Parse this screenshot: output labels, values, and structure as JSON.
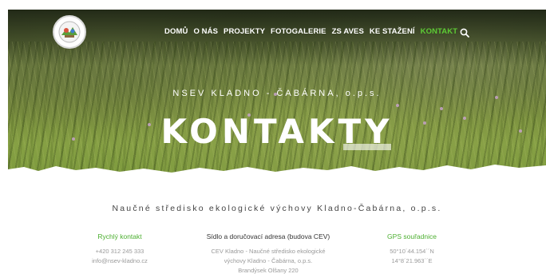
{
  "nav": {
    "items": [
      {
        "label": "DOMŮ"
      },
      {
        "label": "O NÁS"
      },
      {
        "label": "PROJEKTY"
      },
      {
        "label": "FOTOGALERIE"
      },
      {
        "label": "ZS AVES"
      },
      {
        "label": "KE STAŽENÍ"
      },
      {
        "label": "KONTAKT"
      }
    ],
    "active_index": 6,
    "active_color": "#5dcc35",
    "search_icon": "search-icon"
  },
  "hero": {
    "subtitle": "NSEV KLADNO - ČABÁRNA, o.p.s.",
    "title": "KONTAKTY"
  },
  "content": {
    "center_name": "Naučné středisko ekologické výchovy Kladno-Čabárna, o.p.s.",
    "quick_contact": {
      "title": "Rychlý kontakt",
      "lines": [
        "+420 312 245 333",
        "info@nsev-kladno.cz"
      ]
    },
    "address": {
      "title": "Sídlo a doručovací adresa (budova CEV)",
      "lines": [
        "CEV Kladno - Naučné středisko ekologické",
        "výchovy Kladno - Čabárna, o.p.s.",
        "Brandýsek Olšany 220"
      ]
    },
    "gps": {
      "title": "GPS souřadnice",
      "lines": [
        "50°10´44.154´´N",
        "14°8´21.963´´E"
      ]
    }
  },
  "colors": {
    "accent_green": "#4caf30",
    "text_dark": "#333333",
    "text_muted": "#9a9a9a"
  }
}
